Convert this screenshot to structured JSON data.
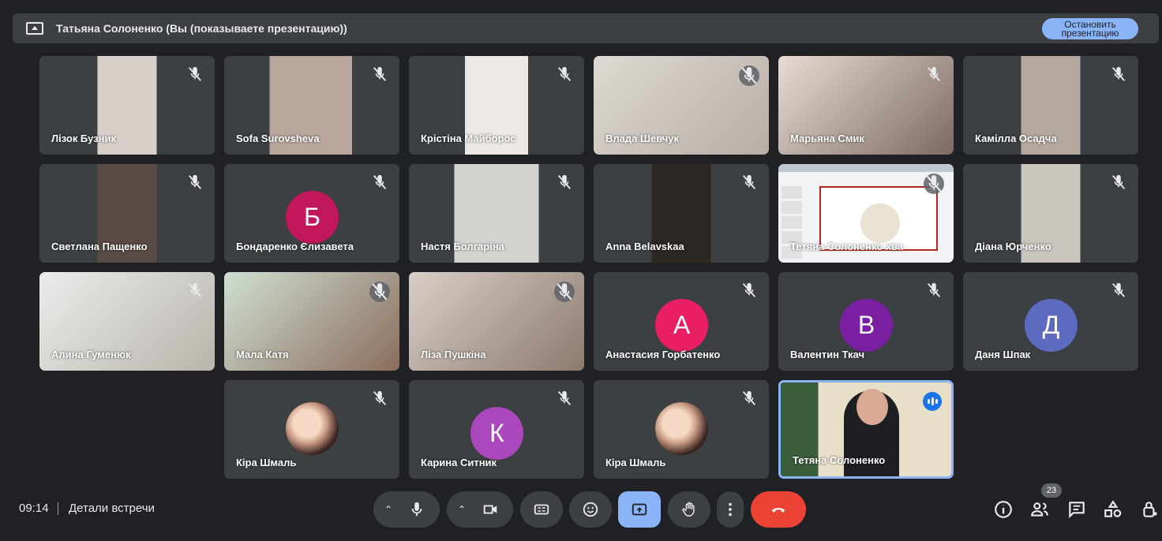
{
  "banner": {
    "text": "Татьяна Солоненко (Вы (показываете презентацию))",
    "stop_line1": "Остановить",
    "stop_line2": "презентацию"
  },
  "participants": [
    {
      "name": "Лізок Бузник",
      "type": "video"
    },
    {
      "name": "Sofa Surovsheva",
      "type": "video"
    },
    {
      "name": "Крістіна Майборос",
      "type": "video"
    },
    {
      "name": "Влада Шевчук",
      "type": "video"
    },
    {
      "name": "Марьяна Смик",
      "type": "video"
    },
    {
      "name": "Камілла Осадча",
      "type": "video"
    },
    {
      "name": "Светлана Пащенко",
      "type": "video"
    },
    {
      "name": "Бондаренко Єлизавета",
      "type": "letter",
      "letter": "Б",
      "color": "#c2185b"
    },
    {
      "name": "Настя Болгаріна",
      "type": "video"
    },
    {
      "name": "Anna Belavskaa",
      "type": "video"
    },
    {
      "name": "Тетяна Солоненко хва",
      "type": "presentation"
    },
    {
      "name": "Діана Юрченко",
      "type": "video"
    },
    {
      "name": "Алина Гуменюк",
      "type": "video"
    },
    {
      "name": "Мала Катя",
      "type": "video"
    },
    {
      "name": "Ліза Пушкіна",
      "type": "video"
    },
    {
      "name": "Анастасия Горбатенко",
      "type": "letter",
      "letter": "А",
      "color": "#e91e63"
    },
    {
      "name": "Валентин Ткач",
      "type": "letter",
      "letter": "В",
      "color": "#7b1fa2"
    },
    {
      "name": "Даня Шпак",
      "type": "letter",
      "letter": "Д",
      "color": "#5c6bc0"
    },
    {
      "name": "Кіра Шмаль",
      "type": "photo"
    },
    {
      "name": "Карина Ситник",
      "type": "letter",
      "letter": "К",
      "color": "#ab47bc"
    },
    {
      "name": "Кіра Шмаль",
      "type": "photo"
    },
    {
      "name": "Тетяна Солоненко",
      "type": "self"
    }
  ],
  "bottom": {
    "time": "09:14",
    "details": "Детали встречи",
    "participants_count": "23"
  },
  "colors": {
    "accent": "#8ab4f8",
    "hangup": "#ea4335",
    "background": "#202124",
    "tile": "#3c4043"
  }
}
